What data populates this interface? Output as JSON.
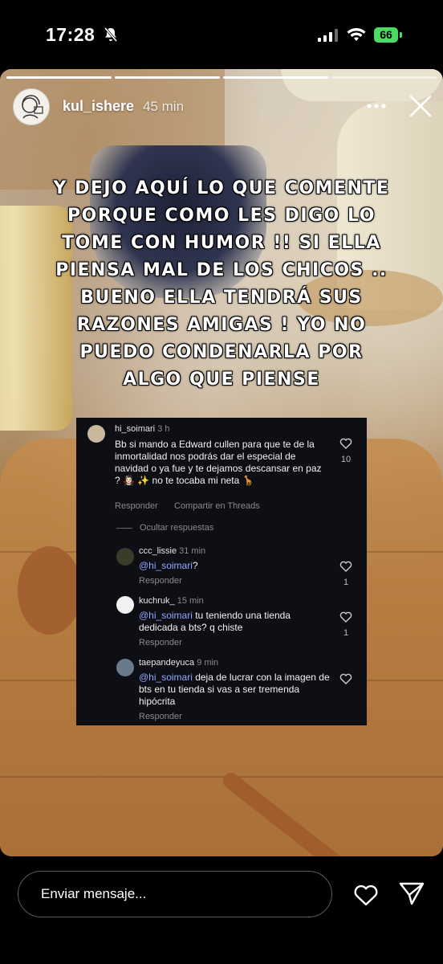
{
  "status_bar": {
    "time": "17:28",
    "battery": "66"
  },
  "story": {
    "username": "kul_ishere",
    "time_ago": "45 min",
    "caption": "Y DEJO AQUÍ LO QUE COMENTE PORQUE COMO LES DIGO LO TOME CON HUMOR !! SI ELLA PIENSA MAL DE LOS CHICOS .. BUENO ELLA TENDRÁ SUS RAZONES AMIGAS ! YO NO PUEDO CONDENARLA POR ALGO QUE PIENSE",
    "progress_segments": 4,
    "progress_done": 3
  },
  "comments": {
    "main": {
      "user": "hi_soimari",
      "when": "3 h",
      "text": "Bb si mando a Edward cullen para que te de la inmortalidad nos podrás dar el especial de navidad o ya fue y te dejamos descansar en paz ? 🧛🏻‍♀️ ✨  no te tocaba mi neta 🦒",
      "likes": "10",
      "reply_label": "Responder",
      "share_label": "Compartir en Threads",
      "hide_replies": "Ocultar respuestas"
    },
    "replies": [
      {
        "user": "ccc_lissie",
        "when": "31 min",
        "mention": "@hi_soimari",
        "text": "?",
        "reply_label": "Responder",
        "likes": "1"
      },
      {
        "user": "kuchruk_",
        "when": "15 min",
        "mention": "@hi_soimari",
        "text": " tu teniendo una tienda dedicada a bts? q chiste",
        "reply_label": "Responder",
        "likes": "1"
      },
      {
        "user": "taepandeyuca",
        "when": "9 min",
        "mention": "@hi_soimari",
        "text": " deja de lucrar con la imagen de bts en tu tienda si vas a ser tremenda hipócrita",
        "reply_label": "Responder",
        "likes": ""
      }
    ]
  },
  "bottom_bar": {
    "message_placeholder": "Enviar mensaje..."
  }
}
